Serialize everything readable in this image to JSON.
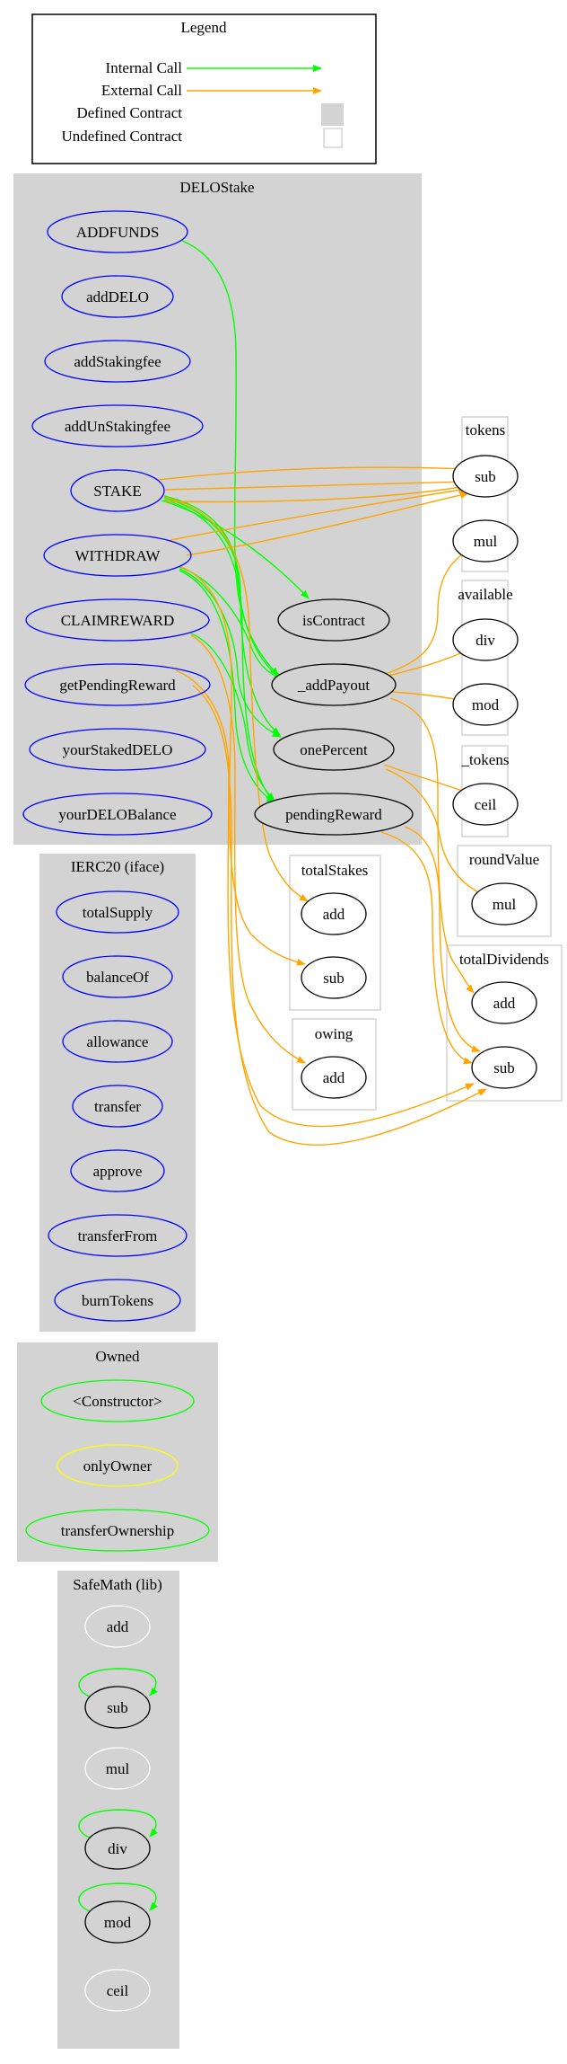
{
  "legend": {
    "title": "Legend",
    "internal_call": "Internal Call",
    "external_call": "External Call",
    "defined_contract": "Defined Contract",
    "undefined_contract": "Undefined Contract"
  },
  "colors": {
    "internal": "#00ff00",
    "external": "#ffa500",
    "defined_fill": "#d3d3d3",
    "undefined_border": "#d3d3d3",
    "public_node": "#0000ff",
    "internal_node": "#000000",
    "modifier_node": "#ffff00",
    "constructor_node": "#00ff00",
    "lib_unused_node": "#ffffff"
  },
  "clusters": {
    "delostake": {
      "title": "DELOStake",
      "nodes": [
        "ADDFUNDS",
        "addDELO",
        "addStakingfee",
        "addUnStakingfee",
        "STAKE",
        "WITHDRAW",
        "CLAIMREWARD",
        "getPendingReward",
        "yourStakedDELO",
        "yourDELOBalance",
        "isContract",
        "_addPayout",
        "onePercent",
        "pendingReward"
      ]
    },
    "ierc20": {
      "title": "IERC20  (iface)",
      "nodes": [
        "totalSupply",
        "balanceOf",
        "allowance",
        "transfer",
        "approve",
        "transferFrom",
        "burnTokens"
      ]
    },
    "owned": {
      "title": "Owned",
      "nodes": [
        "<Constructor>",
        "onlyOwner",
        "transferOwnership"
      ]
    },
    "safemath": {
      "title": "SafeMath  (lib)",
      "nodes": [
        "add",
        "sub",
        "mul",
        "div",
        "mod",
        "ceil"
      ]
    },
    "tokens": {
      "title": "tokens",
      "nodes": [
        "sub",
        "mul"
      ]
    },
    "available": {
      "title": "available",
      "nodes": [
        "div",
        "mod"
      ]
    },
    "_tokens": {
      "title": "_tokens",
      "nodes": [
        "ceil"
      ]
    },
    "roundValue": {
      "title": "roundValue",
      "nodes": [
        "mul"
      ]
    },
    "totalStakes": {
      "title": "totalStakes",
      "nodes": [
        "add",
        "sub"
      ]
    },
    "owing": {
      "title": "owing",
      "nodes": [
        "add"
      ]
    },
    "totalDividends": {
      "title": "totalDividends",
      "nodes": [
        "add",
        "sub"
      ]
    }
  },
  "edges": [
    {
      "from": "ADDFUNDS",
      "to": "_addPayout",
      "type": "internal"
    },
    {
      "from": "STAKE",
      "to": "isContract",
      "type": "internal"
    },
    {
      "from": "STAKE",
      "to": "_addPayout",
      "type": "internal"
    },
    {
      "from": "STAKE",
      "to": "onePercent",
      "type": "internal"
    },
    {
      "from": "STAKE",
      "to": "pendingReward",
      "type": "internal"
    },
    {
      "from": "WITHDRAW",
      "to": "_addPayout",
      "type": "internal"
    },
    {
      "from": "WITHDRAW",
      "to": "onePercent",
      "type": "internal"
    },
    {
      "from": "WITHDRAW",
      "to": "pendingReward",
      "type": "internal"
    },
    {
      "from": "CLAIMREWARD",
      "to": "pendingReward",
      "type": "internal"
    },
    {
      "from": "STAKE",
      "to": "tokens.sub",
      "type": "external"
    },
    {
      "from": "STAKE",
      "to": "tokens.sub",
      "type": "external"
    },
    {
      "from": "STAKE",
      "to": "tokens.sub",
      "type": "external"
    },
    {
      "from": "WITHDRAW",
      "to": "tokens.sub",
      "type": "external"
    },
    {
      "from": "WITHDRAW",
      "to": "tokens.sub",
      "type": "external"
    },
    {
      "from": "_addPayout",
      "to": "tokens.mul",
      "type": "external"
    },
    {
      "from": "_addPayout",
      "to": "available.div",
      "type": "external"
    },
    {
      "from": "_addPayout",
      "to": "available.mod",
      "type": "external"
    },
    {
      "from": "_addPayout",
      "to": "totalDividends.add",
      "type": "external"
    },
    {
      "from": "onePercent",
      "to": "_tokens.ceil",
      "type": "external"
    },
    {
      "from": "onePercent",
      "to": "roundValue.mul",
      "type": "external"
    },
    {
      "from": "STAKE",
      "to": "totalStakes.add",
      "type": "external"
    },
    {
      "from": "WITHDRAW",
      "to": "totalStakes.sub",
      "type": "external"
    },
    {
      "from": "CLAIMREWARD",
      "to": "owing.add",
      "type": "external"
    },
    {
      "from": "pendingReward",
      "to": "totalDividends.sub",
      "type": "external"
    },
    {
      "from": "pendingReward",
      "to": "totalDividends.sub",
      "type": "external"
    },
    {
      "from": "getPendingReward",
      "to": "totalDividends.sub",
      "type": "external"
    },
    {
      "from": "STAKE",
      "to": "totalDividends.sub",
      "type": "external"
    },
    {
      "from": "SafeMath.sub",
      "to": "SafeMath.sub",
      "type": "internal"
    },
    {
      "from": "SafeMath.div",
      "to": "SafeMath.div",
      "type": "internal"
    },
    {
      "from": "SafeMath.mod",
      "to": "SafeMath.mod",
      "type": "internal"
    }
  ]
}
